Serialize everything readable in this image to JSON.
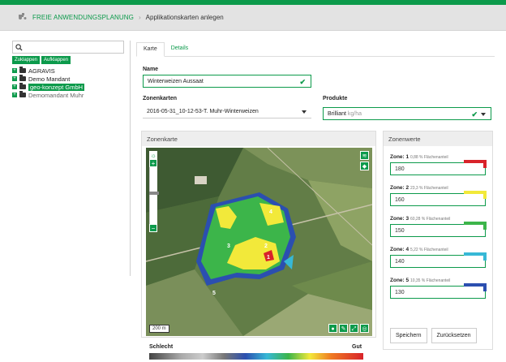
{
  "breadcrumb": {
    "home_icon": "tractor-icon",
    "home_label": "FREIE ANWENDUNGSPLANUNG",
    "separator": "›",
    "current": "Applikationskarten anlegen"
  },
  "sidebar": {
    "search_placeholder": "",
    "collapse_label": "Zuklappen",
    "expand_label": "Aufklappen",
    "items": [
      {
        "label": "AGRAVIS",
        "selected": false
      },
      {
        "label": "Demo Mandant",
        "selected": false
      },
      {
        "label": "geo-konzept GmbH",
        "selected": true
      },
      {
        "label": "Demomandant Muhr",
        "selected": false
      }
    ]
  },
  "tabs": [
    {
      "label": "Karte",
      "active": true
    },
    {
      "label": "Details",
      "active": false
    }
  ],
  "form": {
    "name_label": "Name",
    "name_value": "Winterweizen Aussaat",
    "zonenkarten_label": "Zonenkarten",
    "zonenkarten_value": "2016-05-31_10-12-53-T. Muhr-Winterweizen",
    "produkte_label": "Produkte",
    "produkte_value": "Brilliant",
    "produkte_unit": "kg/ha"
  },
  "map": {
    "title": "Zonenkarte",
    "scale_label": "200 m",
    "zoom_in": "+",
    "zoom_out": "−",
    "zone_labels": [
      "1",
      "2",
      "3",
      "4",
      "5"
    ]
  },
  "gradient": {
    "left_label": "Schlecht",
    "right_label": "Gut"
  },
  "zones": {
    "title": "Zonenwerte",
    "items": [
      {
        "label": "Zone: 1",
        "percent": "0,88 % Flächenanteil",
        "value": "180",
        "color": "#d8232a"
      },
      {
        "label": "Zone: 2",
        "percent": "23,3 % Flächenanteil",
        "value": "160",
        "color": "#f2e93a"
      },
      {
        "label": "Zone: 3",
        "percent": "60,28 % Flächenanteil",
        "value": "150",
        "color": "#3cb54a"
      },
      {
        "label": "Zone: 4",
        "percent": "5,22 % Flächenanteil",
        "value": "140",
        "color": "#37b8d6"
      },
      {
        "label": "Zone: 5",
        "percent": "10,35 % Flächenanteil",
        "value": "130",
        "color": "#2b4fb0"
      }
    ],
    "save_label": "Speichern",
    "reset_label": "Zurücksetzen"
  }
}
